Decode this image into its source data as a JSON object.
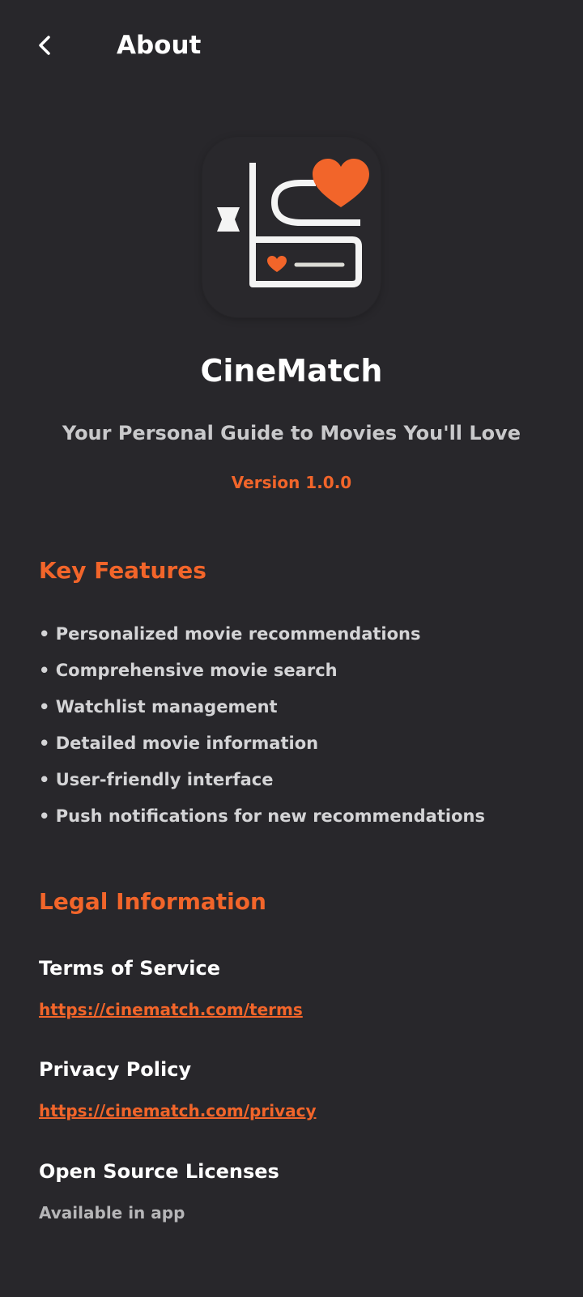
{
  "header": {
    "back_icon": "chevron-left-icon",
    "title": "About"
  },
  "app": {
    "name": "CineMatch",
    "tagline": "Your Personal Guide to Movies You'll Love",
    "version": "Version 1.0.0",
    "icon": "cinematch-logo"
  },
  "features": {
    "title": "Key Features",
    "items": [
      "• Personalized movie recommendations",
      "• Comprehensive movie search",
      "• Watchlist management",
      "• Detailed movie information",
      "• User-friendly interface",
      "• Push notifications for new recommendations"
    ]
  },
  "legal": {
    "title": "Legal Information",
    "terms_label": "Terms of Service",
    "terms_url": "https://cinematch.com/terms",
    "privacy_label": "Privacy Policy",
    "privacy_url": "https://cinematch.com/privacy",
    "licenses_label": "Open Source Licenses",
    "licenses_note": "Available in app"
  },
  "colors": {
    "background": "#28272b",
    "accent": "#f2652a",
    "text": "#ffffff",
    "muted": "#c9c9cb"
  }
}
